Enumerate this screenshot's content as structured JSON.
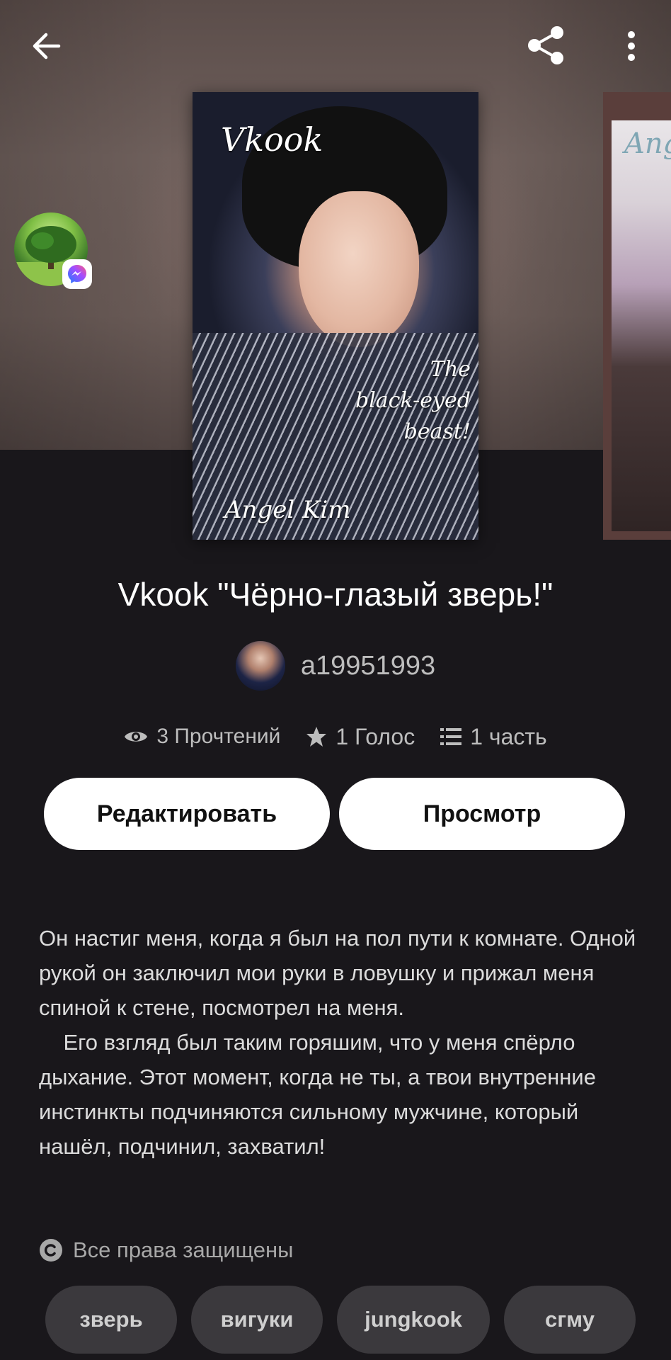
{
  "header": {
    "back_icon": "arrow-left-icon",
    "share_icon": "share-icon",
    "more_icon": "more-vertical-icon"
  },
  "cover": {
    "title_text": "Vkook",
    "subtitle_lines": [
      "The",
      "black-eyed",
      "beast!"
    ],
    "signature": "Angel Kim",
    "next_cover_text": "Ange"
  },
  "story": {
    "title": "Vkook \"Чёрно-глазый зверь!\"",
    "author": "a19951993"
  },
  "stats": {
    "reads": "3 Прочтений",
    "votes": "1 Голос",
    "parts": "1 часть"
  },
  "buttons": {
    "edit": "Редактировать",
    "view": "Просмотр"
  },
  "description": "Он настиг меня, когда я был на пол пути к комнате. Одной рукой он заключил мои руки в ловушку и прижал меня спиной к стене, посмотрел на меня.\n    Его взгляд был таким горяшим, что у меня спёрло дыхание. Этот момент, когда не ты, а твои внутренние инстинкты подчиняются сильному мужчине, который нашёл, подчинил, захватил!",
  "copyright": "Все права защищены",
  "tags": [
    "зверь",
    "вигуки",
    "jungkook",
    "сгму"
  ]
}
